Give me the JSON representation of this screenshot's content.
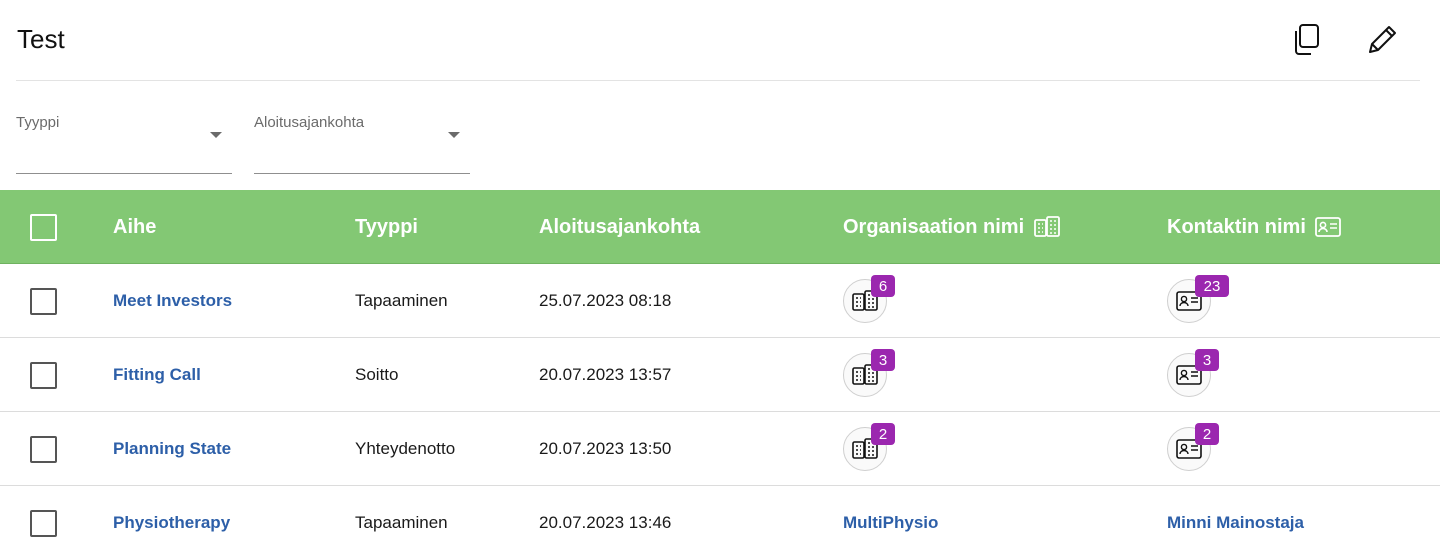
{
  "header": {
    "title": "Test"
  },
  "filters": [
    {
      "label": "Tyyppi"
    },
    {
      "label": "Aloitusajankohta"
    }
  ],
  "table": {
    "columns": {
      "subject": "Aihe",
      "type": "Tyyppi",
      "start": "Aloitusajankohta",
      "organization": "Organisaation nimi",
      "contact": "Kontaktin nimi"
    },
    "rows": [
      {
        "subject": "Meet Investors",
        "type": "Tapaaminen",
        "start": "25.07.2023 08:18",
        "org_count": "6",
        "contact_count": "23"
      },
      {
        "subject": "Fitting Call",
        "type": "Soitto",
        "start": "20.07.2023 13:57",
        "org_count": "3",
        "contact_count": "3"
      },
      {
        "subject": "Planning State",
        "type": "Yhteydenotto",
        "start": "20.07.2023 13:50",
        "org_count": "2",
        "contact_count": "2"
      },
      {
        "subject": "Physiotherapy",
        "type": "Tapaaminen",
        "start": "20.07.2023 13:46",
        "organization": "MultiPhysio",
        "contact": "Minni Mainostaja"
      }
    ]
  },
  "icons": {
    "copy": "copy-icon",
    "edit": "pencil-icon",
    "organization": "buildings-icon",
    "contact": "contact-card-icon"
  },
  "colors": {
    "header_bg": "#83c874",
    "link": "#2d5fa8",
    "badge": "#9b27af"
  }
}
